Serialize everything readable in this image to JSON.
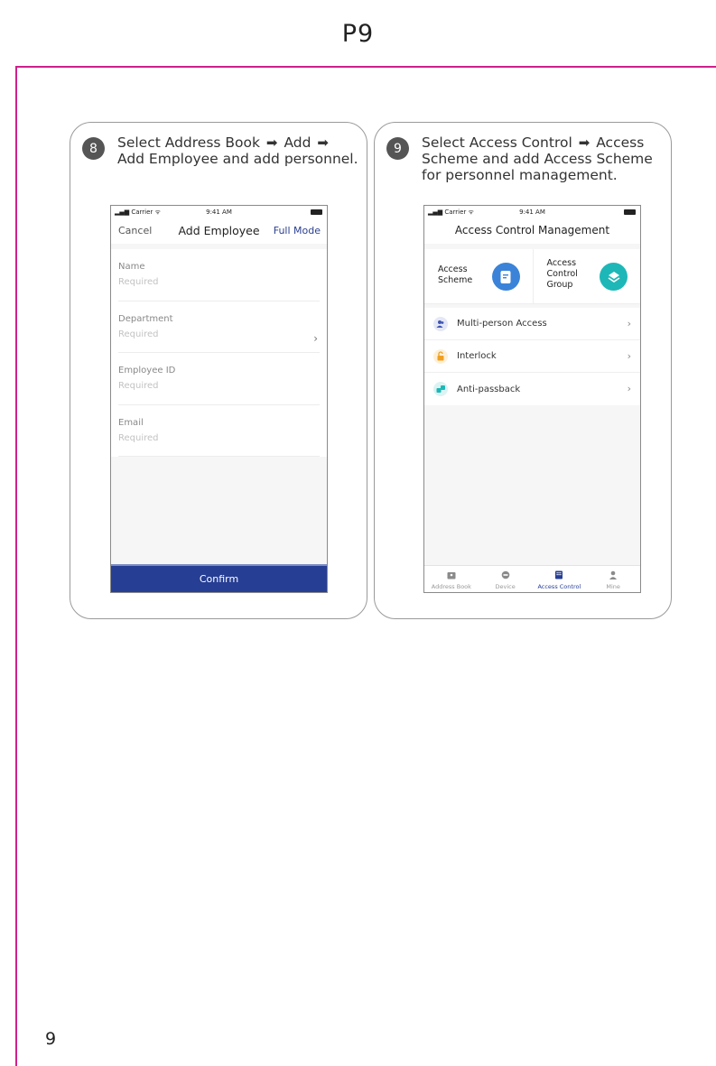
{
  "page": {
    "title": "P9",
    "number": "9"
  },
  "step8": {
    "badge": "8",
    "line1": "Select Address Book",
    "line1b": "Add",
    "line2": "Add Employee and add personnel.",
    "phone": {
      "carrier": "Carrier",
      "time": "9:41 AM",
      "cancel": "Cancel",
      "title": "Add Employee",
      "full_mode": "Full Mode",
      "fields": [
        {
          "label": "Name",
          "placeholder": "Required"
        },
        {
          "label": "Department",
          "placeholder": "Required"
        },
        {
          "label": "Employee ID",
          "placeholder": "Required"
        },
        {
          "label": "Email",
          "placeholder": "Required"
        }
      ],
      "confirm": "Confirm"
    }
  },
  "step9": {
    "badge": "9",
    "line1a": "Select Access Control",
    "line1b": "Access",
    "line2": "Scheme and add Access Scheme",
    "line3": "for personnel management.",
    "phone": {
      "carrier": "Carrier",
      "time": "9:41 AM",
      "title": "Access Control Management",
      "tile1": {
        "line1": "Access",
        "line2": "Scheme",
        "icon": "document-icon"
      },
      "tile2": {
        "line1": "Access",
        "line2": "Control",
        "line3": "Group",
        "icon": "layers-icon"
      },
      "rows": [
        {
          "label": "Multi-person Access",
          "icon": "people-icon",
          "color": "#3f56b0"
        },
        {
          "label": "Interlock",
          "icon": "lock-icon",
          "color": "#f0a020"
        },
        {
          "label": "Anti-passback",
          "icon": "swap-icon",
          "color": "#1eb7b7"
        }
      ],
      "tabs": [
        {
          "label": "Address Book",
          "icon": "address-book-icon",
          "active": false
        },
        {
          "label": "Device",
          "icon": "device-icon",
          "active": false
        },
        {
          "label": "Access Control",
          "icon": "access-control-icon",
          "active": true
        },
        {
          "label": "Mine",
          "icon": "user-icon",
          "active": false
        }
      ]
    }
  },
  "colors": {
    "frame": "#d0208a",
    "primary": "#263e94",
    "scheme_icon": "#3a83d8",
    "group_icon": "#1eb7b7"
  }
}
